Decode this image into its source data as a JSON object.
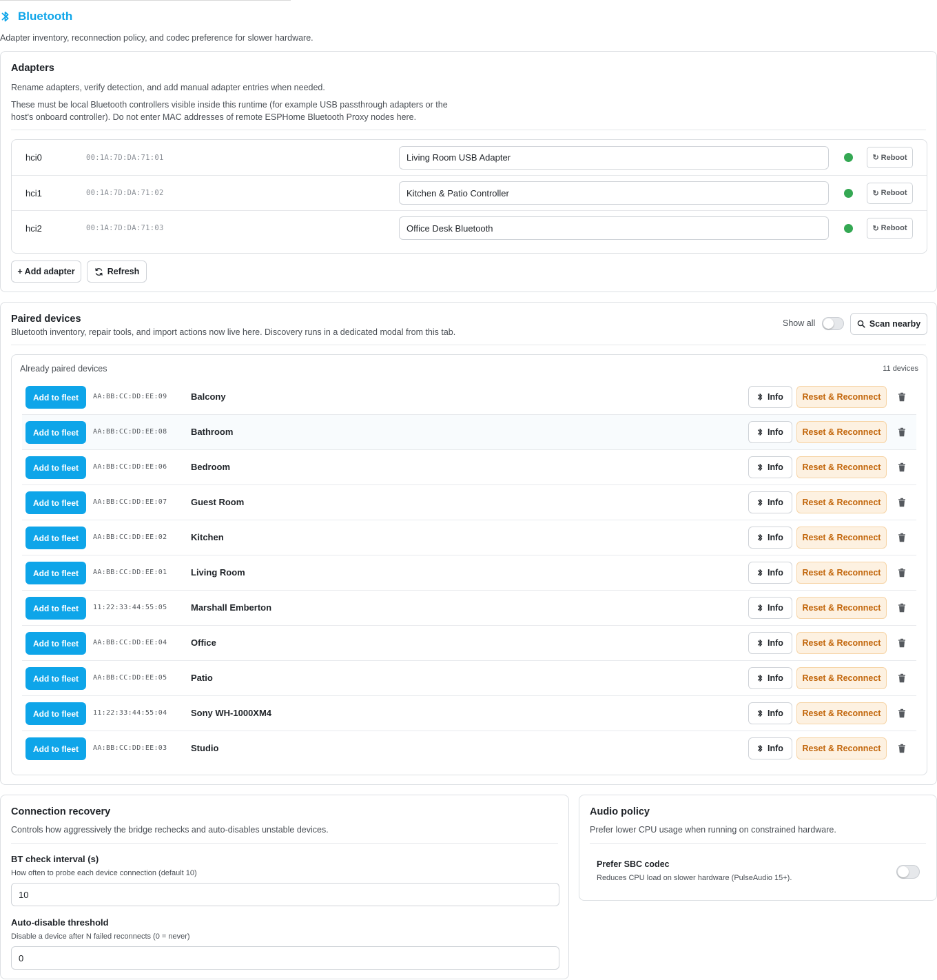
{
  "header": {
    "title": "Bluetooth",
    "subtitle": "Adapter inventory, reconnection policy, and codec preference for slower hardware."
  },
  "adapters": {
    "title": "Adapters",
    "description": "Rename adapters, verify detection, and add manual adapter entries when needed.",
    "note": "These must be local Bluetooth controllers visible inside this runtime (for example USB passthrough adapters or the host's onboard controller). Do not enter MAC addresses of remote ESPHome Bluetooth Proxy nodes here.",
    "reboot_label": "Reboot",
    "status_color": "#34a853",
    "items": [
      {
        "id": "hci0",
        "mac": "00:1A:7D:DA:71:01",
        "name": "Living Room USB Adapter"
      },
      {
        "id": "hci1",
        "mac": "00:1A:7D:DA:71:02",
        "name": "Kitchen & Patio Controller"
      },
      {
        "id": "hci2",
        "mac": "00:1A:7D:DA:71:03",
        "name": "Office Desk Bluetooth"
      }
    ],
    "add_label": "+ Add adapter",
    "refresh_label": "Refresh"
  },
  "paired": {
    "title": "Paired devices",
    "description": "Bluetooth inventory, repair tools, and import actions now live here. Discovery runs in a dedicated modal from this tab.",
    "show_all_label": "Show all",
    "show_all_on": false,
    "scan_label": "Scan nearby",
    "list_title": "Already paired devices",
    "count_label": "11 devices",
    "fleet_label": "Add to fleet",
    "info_label": "Info",
    "reset_label": "Reset & Reconnect",
    "accent_color": "#0ea5e9",
    "devices": [
      {
        "mac": "AA:BB:CC:DD:EE:09",
        "name": "Balcony"
      },
      {
        "mac": "AA:BB:CC:DD:EE:08",
        "name": "Bathroom"
      },
      {
        "mac": "AA:BB:CC:DD:EE:06",
        "name": "Bedroom"
      },
      {
        "mac": "AA:BB:CC:DD:EE:07",
        "name": "Guest Room"
      },
      {
        "mac": "AA:BB:CC:DD:EE:02",
        "name": "Kitchen"
      },
      {
        "mac": "AA:BB:CC:DD:EE:01",
        "name": "Living Room"
      },
      {
        "mac": "11:22:33:44:55:05",
        "name": "Marshall Emberton"
      },
      {
        "mac": "AA:BB:CC:DD:EE:04",
        "name": "Office"
      },
      {
        "mac": "AA:BB:CC:DD:EE:05",
        "name": "Patio"
      },
      {
        "mac": "11:22:33:44:55:04",
        "name": "Sony WH-1000XM4"
      },
      {
        "mac": "AA:BB:CC:DD:EE:03",
        "name": "Studio"
      }
    ]
  },
  "recovery": {
    "title": "Connection recovery",
    "description": "Controls how aggressively the bridge rechecks and auto-disables unstable devices.",
    "check_label": "BT check interval (s)",
    "check_hint": "How often to probe each device connection (default 10)",
    "check_value": "10",
    "disable_label": "Auto-disable threshold",
    "disable_hint": "Disable a device after N failed reconnects (0 = never)",
    "disable_value": "0"
  },
  "audio": {
    "title": "Audio policy",
    "description": "Prefer lower CPU usage when running on constrained hardware.",
    "sbc_label": "Prefer SBC codec",
    "sbc_hint": "Reduces CPU load on slower hardware (PulseAudio 15+).",
    "sbc_on": false
  }
}
